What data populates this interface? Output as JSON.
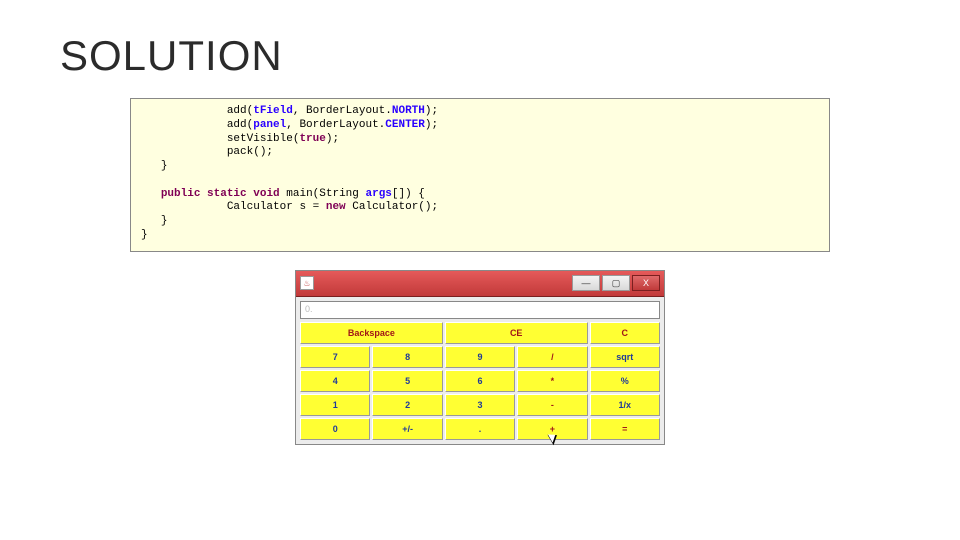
{
  "title": "SOLUTION",
  "code": {
    "l1a": "add(",
    "l1b": "tField",
    "l1c": ", BorderLayout.",
    "l1d": "NORTH",
    "l1e": ");",
    "l2a": "add(",
    "l2b": "panel",
    "l2c": ", BorderLayout.",
    "l2d": "CENTER",
    "l2e": ");",
    "l3a": "setVisible(",
    "l3b": "true",
    "l3c": ");",
    "l4": "pack();",
    "brace1": "}",
    "m1a": "public",
    "m1b": "static",
    "m1c": "void",
    "m1d": "main(String",
    "m1e": "args",
    "m1f": "[]) {",
    "m2a": "Calculator s =",
    "m2b": "new",
    "m2c": "Calculator();",
    "brace2": "}",
    "brace3": "}"
  },
  "window": {
    "java_icon": "♨",
    "min": "—",
    "max": "▢",
    "close": "X"
  },
  "display": {
    "value": "0."
  },
  "keys": {
    "backspace": "Backspace",
    "ce": "CE",
    "c": "C",
    "k7": "7",
    "k8": "8",
    "k9": "9",
    "div": "/",
    "sqrt": "sqrt",
    "k4": "4",
    "k5": "5",
    "k6": "6",
    "mul": "*",
    "pct": "%",
    "k1": "1",
    "k2": "2",
    "k3": "3",
    "sub": "-",
    "inv": "1/x",
    "k0": "0",
    "pm": "+/-",
    "dot": ".",
    "add": "+",
    "eq": "="
  }
}
